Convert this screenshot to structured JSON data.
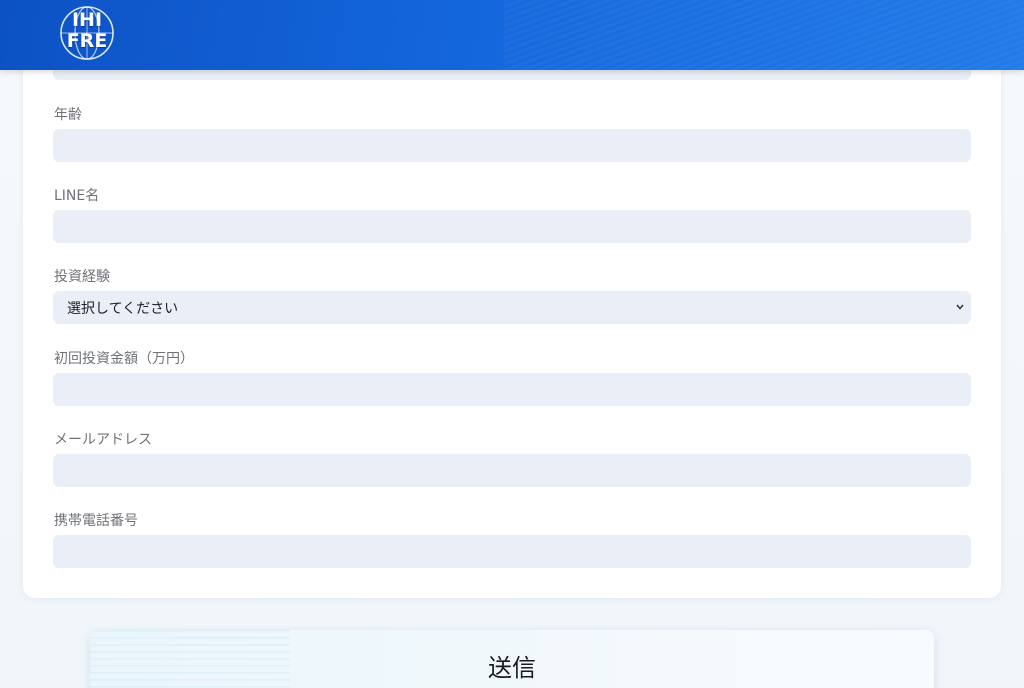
{
  "header": {
    "logo_line1": "IHI",
    "logo_line2": "FRE"
  },
  "form": {
    "fields": [
      {
        "label": "年齢",
        "value": "",
        "placeholder": ""
      },
      {
        "label": "LINE名",
        "value": "",
        "placeholder": ""
      },
      {
        "label": "投資経験",
        "selected": "選択してください"
      },
      {
        "label": "初回投資金額（万円）",
        "value": "",
        "placeholder": ""
      },
      {
        "label": "メールアドレス",
        "value": "",
        "placeholder": ""
      },
      {
        "label": "携帯電話番号",
        "value": "",
        "placeholder": ""
      }
    ]
  },
  "submit": {
    "label": "送信"
  },
  "colors": {
    "header_blue": "#1466dc",
    "input_bg": "#e9eef7",
    "label_gray": "#6f7378"
  }
}
